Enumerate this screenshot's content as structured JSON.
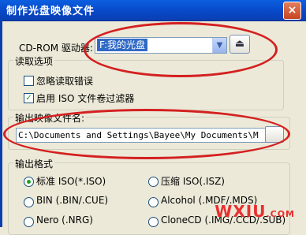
{
  "window": {
    "title": "制作光盘映像文件"
  },
  "drive": {
    "label": "CD-ROM 驱动器:",
    "selected": "F:我的光盘"
  },
  "read_options": {
    "legend": "读取选项",
    "ignore_errors": {
      "label": "忽略读取错误",
      "checked": false
    },
    "iso_filter": {
      "label": "启用 ISO 文件卷过滤器",
      "checked": true
    }
  },
  "output_file": {
    "legend": "输出映像文件名:",
    "path": "C:\\Documents and Settings\\Bayee\\My Documents\\M"
  },
  "output_format": {
    "legend": "输出格式",
    "options": [
      {
        "label": "标准 ISO(*.ISO)",
        "selected": true
      },
      {
        "label": "压缩 ISO(.ISZ)",
        "selected": false
      },
      {
        "label": "BIN (.BIN/.CUE)",
        "selected": false
      },
      {
        "label": "Alcohol (.MDF/.MDS)",
        "selected": false
      },
      {
        "label": "Nero (.NRG)",
        "selected": false
      },
      {
        "label": "CloneCD (.IMG/.CCD/.SUB)",
        "selected": false
      }
    ]
  },
  "watermark": {
    "text": "WXIU",
    "suffix": ".COM"
  },
  "colors": {
    "annotation": "#D42020",
    "titlebar": "#0847C6"
  }
}
